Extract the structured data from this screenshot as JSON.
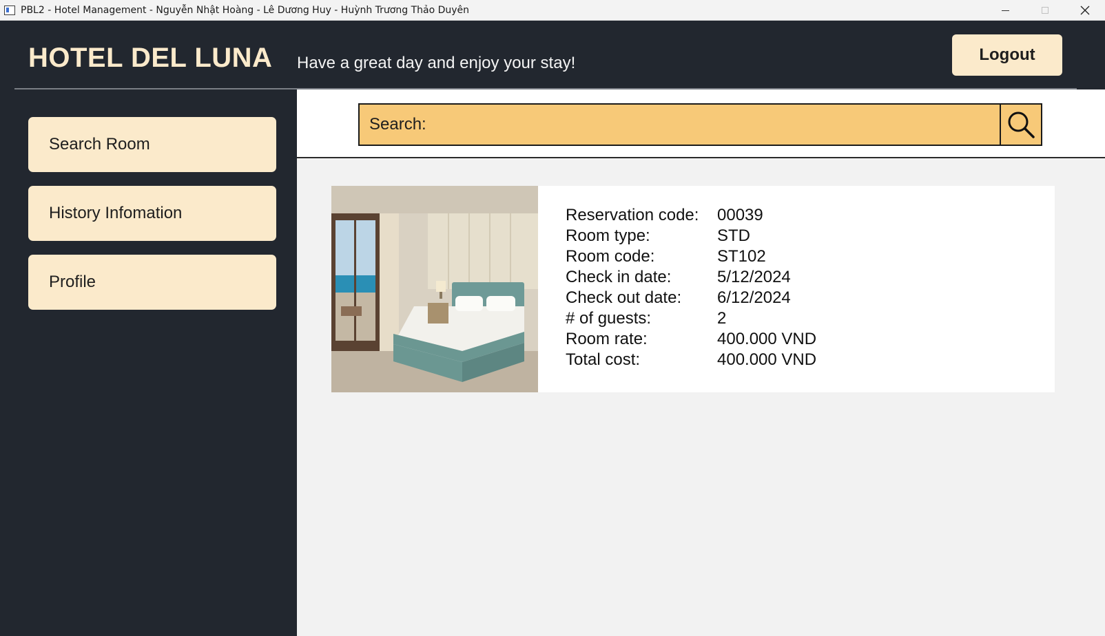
{
  "window": {
    "title": "PBL2 - Hotel Management - Nguyễn Nhật Hoàng - Lê Dương Huy - Huỳnh Trương Thảo Duyên"
  },
  "header": {
    "brand": "HOTEL DEL LUNA",
    "tagline": "Have a great day and enjoy your stay!",
    "logout_label": "Logout"
  },
  "sidebar": {
    "items": [
      {
        "label": "Search Room"
      },
      {
        "label": "History Infomation"
      },
      {
        "label": "Profile"
      }
    ]
  },
  "search": {
    "label": "Search:",
    "button_icon": "search-icon"
  },
  "reservation": {
    "rows": [
      {
        "label": "Reservation code:",
        "value": "00039"
      },
      {
        "label": "Room type:",
        "value": "STD"
      },
      {
        "label": "Room code:",
        "value": "ST102"
      },
      {
        "label": "Check in date:",
        "value": "5/12/2024"
      },
      {
        "label": "Check out date:",
        "value": "6/12/2024"
      },
      {
        "label": "# of guests:",
        "value": "2"
      },
      {
        "label": "Room rate:",
        "value": "400.000 VND"
      },
      {
        "label": "Total cost:",
        "value": "400.000 VND"
      }
    ]
  },
  "colors": {
    "background": "#22272f",
    "button_bg": "#fbeacb",
    "search_bg": "#f7c978",
    "main_bg": "#f2f2f2"
  }
}
